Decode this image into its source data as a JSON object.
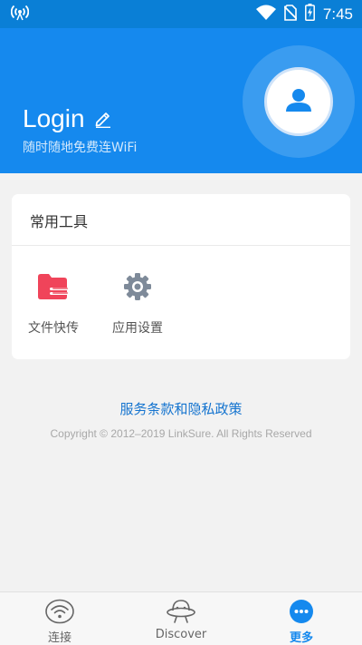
{
  "colors": {
    "brand": "#1589ee",
    "status_bar": "#0a7fd6",
    "link": "#1574cf",
    "tool_files_icon": "#f0445a",
    "tool_settings_icon": "#7e8a99"
  },
  "status_bar": {
    "time": "7:45",
    "icons": [
      "hotspot-icon",
      "wifi-icon",
      "no-sim-icon",
      "battery-charging-icon"
    ]
  },
  "header": {
    "title": "Login",
    "subtitle": "随时随地免费连WiFi",
    "icons": [
      "edit-icon",
      "avatar-icon"
    ]
  },
  "tools": {
    "title": "常用工具",
    "items": [
      {
        "label": "文件快传",
        "icon": "folder-transfer-icon"
      },
      {
        "label": "应用设置",
        "icon": "gear-icon"
      }
    ]
  },
  "footer": {
    "terms": "服务条款和隐私政策",
    "copyright": "Copyright © 2012–2019 LinkSure. All Rights Reserved"
  },
  "bottom_nav": {
    "active": "更多",
    "items": [
      {
        "label": "连接",
        "icon": "wifi-connect-icon"
      },
      {
        "label": "Discover",
        "icon": "ufo-icon"
      },
      {
        "label": "更多",
        "icon": "more-dots-icon"
      }
    ]
  }
}
